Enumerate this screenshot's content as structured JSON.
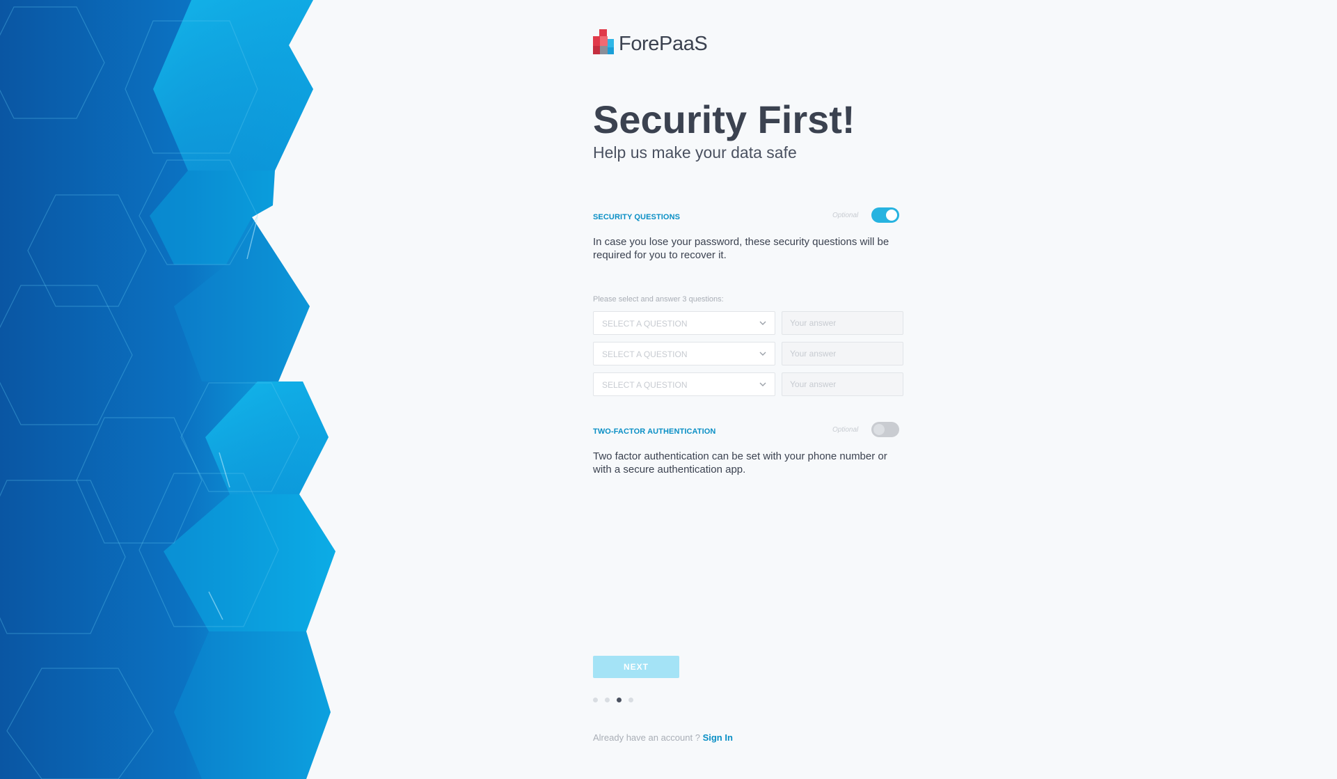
{
  "brand": {
    "name": "ForePaaS"
  },
  "header": {
    "title": "Security First!",
    "subtitle": "Help us make your data safe"
  },
  "security_questions": {
    "title": "SECURITY QUESTIONS",
    "optional_label": "Optional",
    "toggle_on": true,
    "description": "In case you lose your password, these security questions will be required for you to recover it.",
    "instruction": "Please select and answer 3 questions:",
    "rows": [
      {
        "select_label": "SELECT A QUESTION",
        "answer_placeholder": "Your answer"
      },
      {
        "select_label": "SELECT A QUESTION",
        "answer_placeholder": "Your answer"
      },
      {
        "select_label": "SELECT A QUESTION",
        "answer_placeholder": "Your answer"
      }
    ]
  },
  "two_factor": {
    "title": "TWO-FACTOR AUTHENTICATION",
    "optional_label": "Optional",
    "toggle_on": false,
    "description": "Two factor authentication can be set with your phone number or with a secure authentication app."
  },
  "actions": {
    "next_label": "NEXT"
  },
  "progress": {
    "total_steps": 4,
    "current_step": 3
  },
  "footer": {
    "prompt": "Already have an account ? ",
    "signin_label": "Sign In"
  },
  "colors": {
    "accent": "#0a8fc5",
    "toggle_on": "#27b3e0",
    "next_button": "#a4e3f6",
    "hero_dark": "#0a5aa8",
    "hero_light": "#0fb0e8"
  }
}
